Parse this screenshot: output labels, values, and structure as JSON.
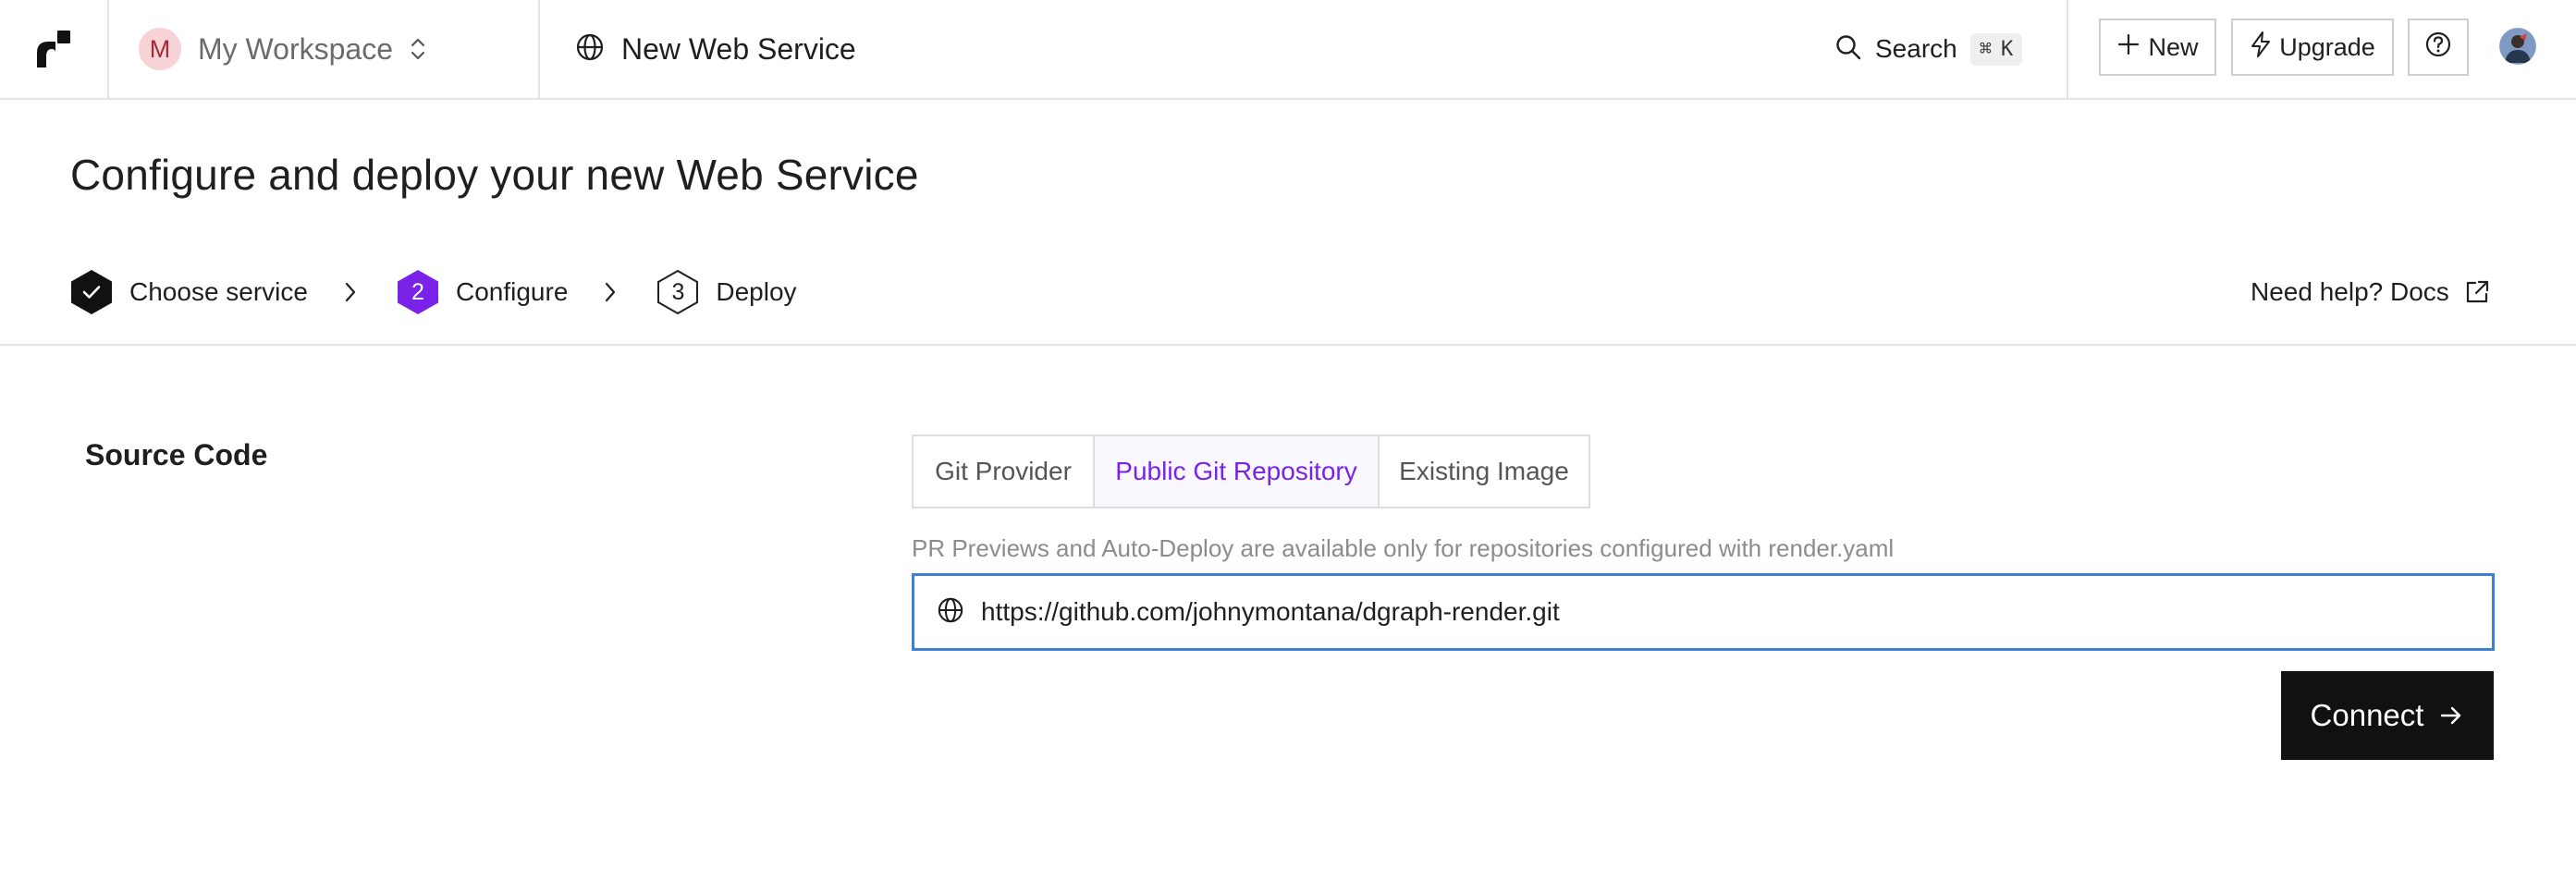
{
  "workspace": {
    "avatar_letter": "M",
    "name": "My Workspace"
  },
  "header": {
    "service_title": "New Web Service"
  },
  "search": {
    "label": "Search",
    "shortcut_cmd": "⌘",
    "shortcut_key": "K"
  },
  "actions": {
    "new_label": "New",
    "upgrade_label": "Upgrade"
  },
  "page": {
    "title": "Configure and deploy your new Web Service"
  },
  "steps": [
    {
      "label": "Choose service",
      "state": "complete",
      "number": ""
    },
    {
      "label": "Configure",
      "state": "active",
      "number": "2"
    },
    {
      "label": "Deploy",
      "state": "pending",
      "number": "3"
    }
  ],
  "help": {
    "label": "Need help? Docs"
  },
  "source": {
    "section_label": "Source Code",
    "tabs": [
      {
        "label": "Git Provider",
        "selected": false
      },
      {
        "label": "Public Git Repository",
        "selected": true
      },
      {
        "label": "Existing Image",
        "selected": false
      }
    ],
    "hint": "PR Previews and Auto-Deploy are available only for repositories configured with render.yaml",
    "url_value": "https://github.com/johnymontana/dgraph-render.git",
    "connect_label": "Connect"
  },
  "colors": {
    "accent": "#7a22e8",
    "focus_border": "#3f7fd4",
    "primary_button": "#111111",
    "workspace_avatar_bg": "#f7d3d6"
  }
}
